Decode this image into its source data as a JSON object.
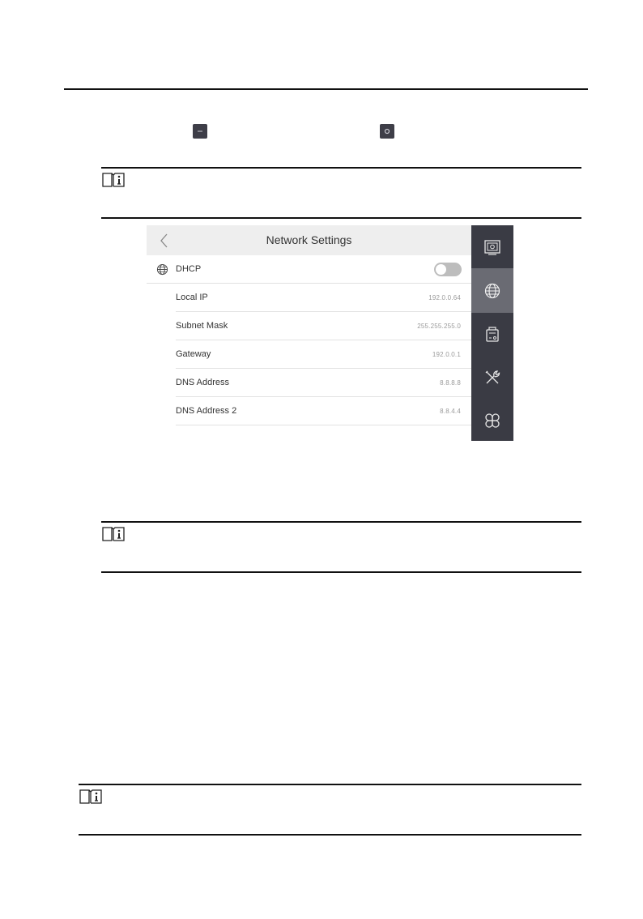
{
  "screen": {
    "header": {
      "back_icon": "chevron-left-icon",
      "title": "Network Settings"
    },
    "rows": [
      {
        "label": "DHCP",
        "icon": "globe-icon",
        "control": "toggle",
        "toggle_on": false
      },
      {
        "label": "Local IP",
        "value": "192.0.0.64"
      },
      {
        "label": "Subnet Mask",
        "value": "255.255.255.0"
      },
      {
        "label": "Gateway",
        "value": "192.0.0.1"
      },
      {
        "label": "DNS Address",
        "value": "8.8.8.8"
      },
      {
        "label": "DNS Address 2",
        "value": "8.8.4.4"
      }
    ],
    "sidebar": [
      {
        "icon": "monitor-icon",
        "active": false
      },
      {
        "icon": "globe-icon",
        "active": true
      },
      {
        "icon": "device-icon",
        "active": false
      },
      {
        "icon": "tools-icon",
        "active": false
      },
      {
        "icon": "apps-icon",
        "active": false
      }
    ]
  },
  "doc": {
    "note_icons": [
      "note-icon",
      "note-icon",
      "note-icon"
    ],
    "inline_glyphs": [
      "settings-small-icon",
      "gear-small-icon"
    ]
  },
  "colors": {
    "sidebar": "#3a3b44",
    "sidebar_active": "#6a6b73",
    "header": "#eeeeee",
    "toggle_off": "#bdbdbd"
  }
}
